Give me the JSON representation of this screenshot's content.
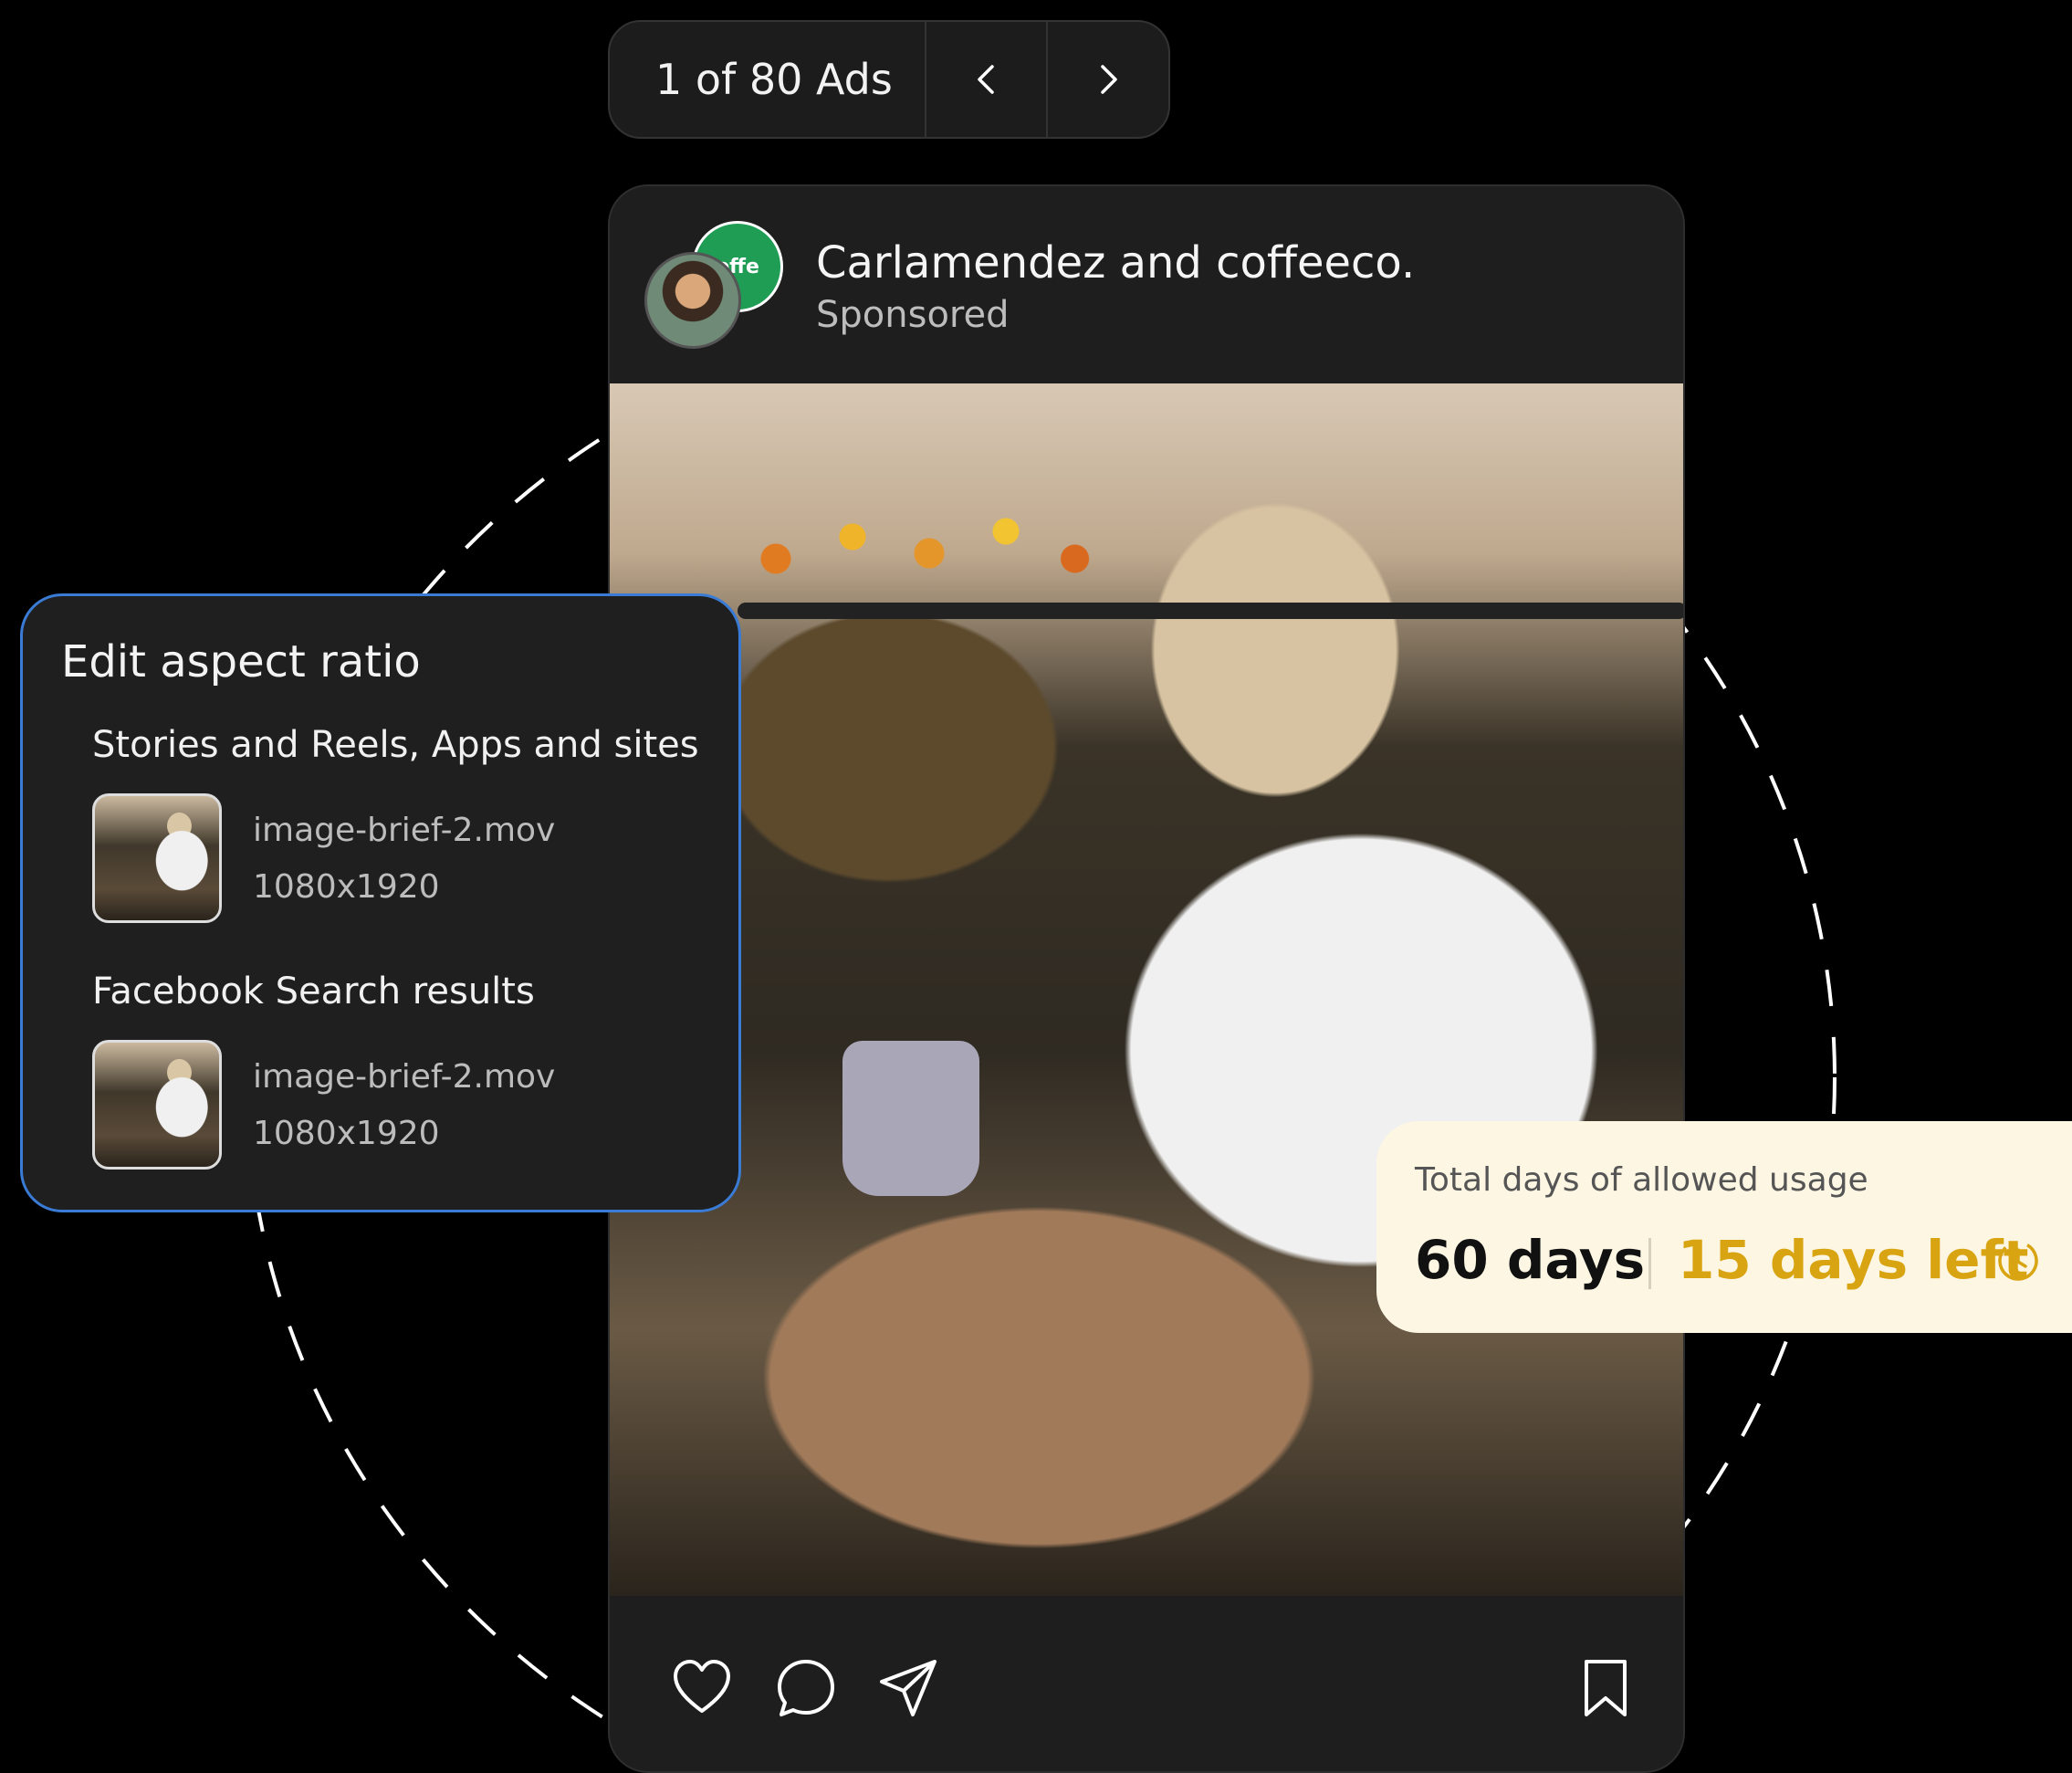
{
  "pager": {
    "label": "1 of 80 Ads"
  },
  "post": {
    "title": "Carlamendez and coffeeco.",
    "subtitle": "Sponsored",
    "brand_avatar_text": "offe"
  },
  "aspect_panel": {
    "title": "Edit aspect ratio",
    "sections": [
      {
        "title": "Stories and Reels, Apps and sites",
        "file_name": "image-brief-2.mov",
        "file_size": "1080x1920"
      },
      {
        "title": "Facebook Search results",
        "file_name": "image-brief-2.mov",
        "file_size": "1080x1920"
      }
    ]
  },
  "usage": {
    "label": "Total days of allowed usage",
    "days": "60 days",
    "remaining": "15 days left"
  },
  "colors": {
    "accent_blue": "#3a7bd5",
    "usage_bg": "#fdf6e3",
    "remaining_text": "#d9a412",
    "brand_green": "#1f9d55"
  },
  "icons": [
    "chevron-left-icon",
    "chevron-right-icon",
    "heart-icon",
    "comment-icon",
    "share-icon",
    "bookmark-icon",
    "clock-icon"
  ]
}
